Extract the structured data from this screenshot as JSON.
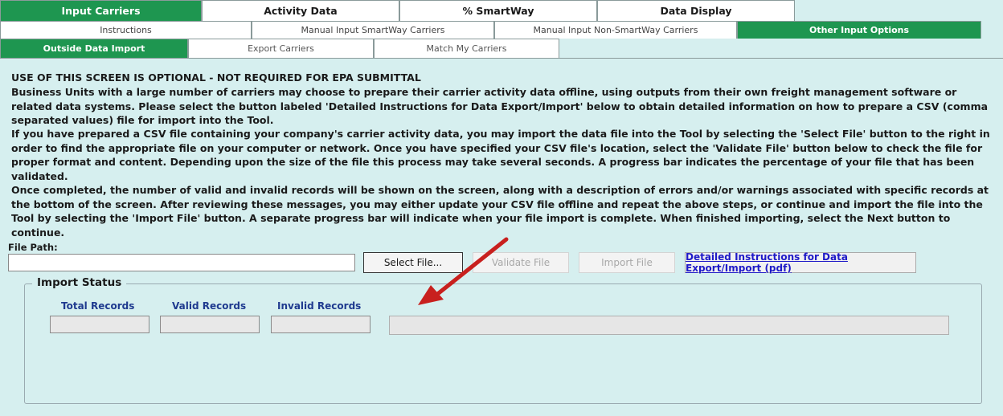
{
  "tabs_main": [
    {
      "label": "Input Carriers",
      "active": true
    },
    {
      "label": "Activity Data",
      "active": false
    },
    {
      "label": "% SmartWay",
      "active": false
    },
    {
      "label": "Data Display",
      "active": false
    }
  ],
  "tabs_sub": [
    {
      "label": "Instructions",
      "active": false
    },
    {
      "label": "Manual Input SmartWay Carriers",
      "active": false
    },
    {
      "label": "Manual Input Non-SmartWay Carriers",
      "active": false
    },
    {
      "label": "Other Input Options",
      "active": true
    }
  ],
  "tabs_options": [
    {
      "label": "Outside Data Import",
      "active": true
    },
    {
      "label": "Export Carriers",
      "active": false
    },
    {
      "label": "Match My Carriers",
      "active": false
    }
  ],
  "main": {
    "note": "USE OF THIS SCREEN IS OPTIONAL - NOT REQUIRED FOR EPA SUBMITTAL",
    "para1": "Business Units with a large number of carriers may choose to prepare their carrier activity data offline, using outputs from their own freight management software or related data systems.  Please select the button labeled 'Detailed Instructions for Data Export/Import' below to obtain detailed information on how to prepare a CSV (comma separated values) file for import into the Tool.",
    "para2": "If you have prepared a CSV file containing your company's carrier activity data, you may import the data file into the Tool by selecting the 'Select File' button to the right in order to find the appropriate file on your computer or network. Once you have specified your CSV file's location, select the 'Validate File' button below to check the file for proper format and content.  Depending upon the size of the file this process may take several seconds.  A progress bar indicates the percentage of your file that has been validated.",
    "para3": "Once completed, the number of valid and invalid records will be shown on the screen, along with a description of errors and/or warnings associated with specific records at the bottom of the screen.  After reviewing these messages, you may either update your CSV file offline and repeat the above steps, or continue and import the file into the Tool by selecting the 'Import File' button. A separate progress bar will indicate when your file import is complete. When finished importing, select the Next button to continue."
  },
  "file": {
    "path_label": "File Path:",
    "path_value": "",
    "select_label": "Select File...",
    "validate_label": "Validate File",
    "import_label": "Import File",
    "detailed_label": "Detailed Instructions for Data Export/Import (pdf)"
  },
  "status": {
    "title": "Import Status",
    "total_label": "Total Records",
    "valid_label": "Valid Records",
    "invalid_label": "Invalid Records",
    "total_value": "",
    "valid_value": "",
    "invalid_value": ""
  },
  "colors": {
    "active_tab": "#1e9650",
    "background": "#d6efef",
    "link": "#1f1ac8",
    "status_label": "#1f3a8f",
    "annotation_arrow": "#c8201e"
  },
  "icons": {
    "annotation": "red-pointer-arrow"
  }
}
